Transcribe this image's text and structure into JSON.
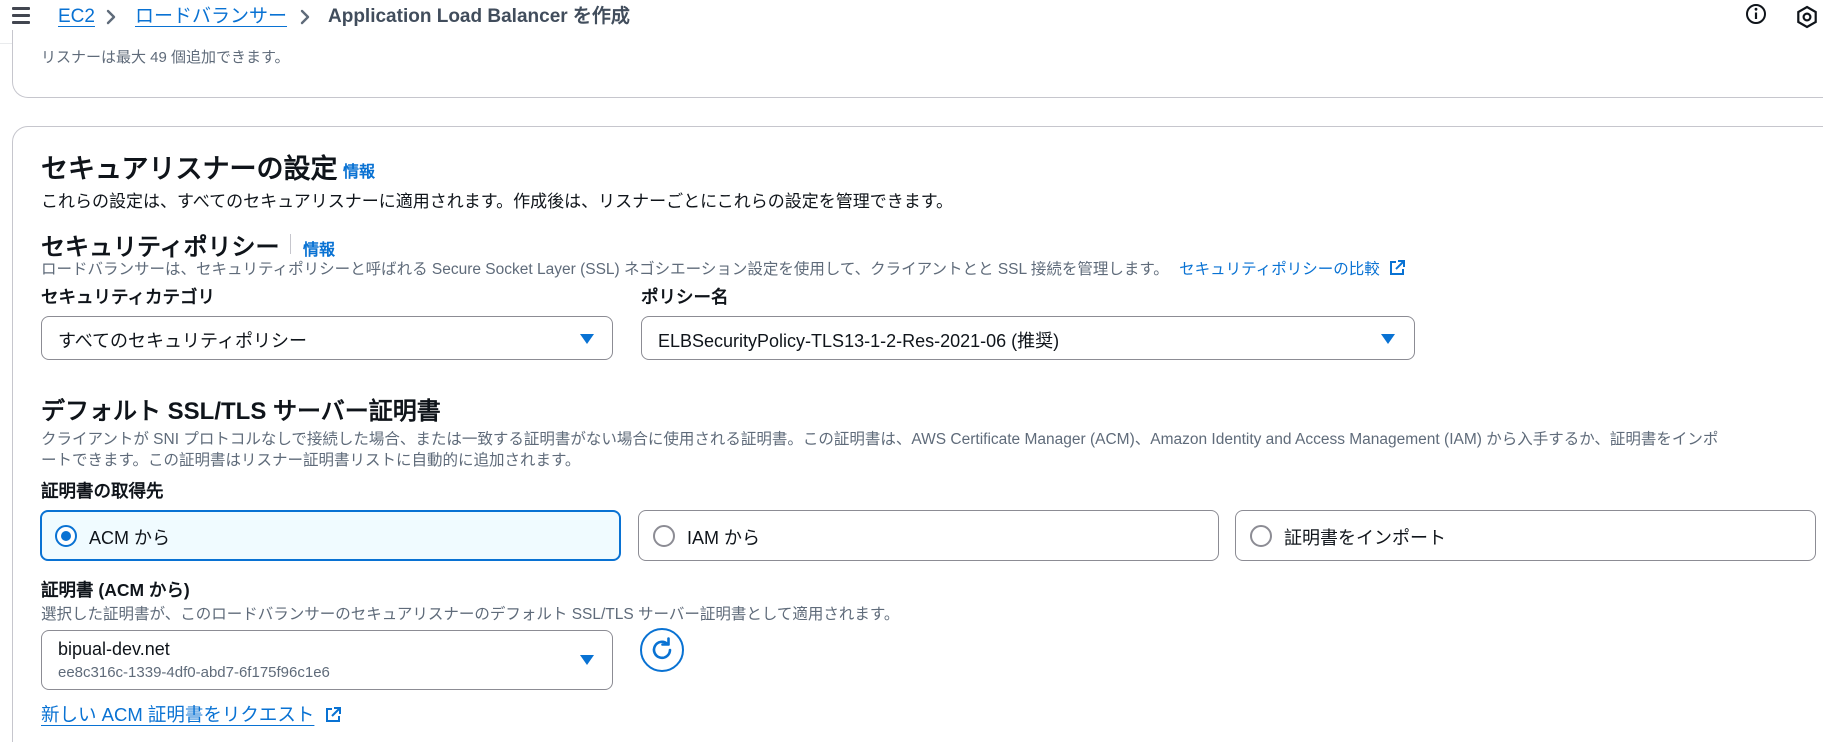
{
  "header": {
    "breadcrumb": {
      "ec2": "EC2",
      "load_balancers": "ロードバランサー",
      "current": "Application Load Balancer を作成"
    },
    "icons": [
      "menu-icon",
      "chevron-right-icon",
      "info-icon",
      "settings-hex-icon"
    ]
  },
  "listener_note": "リスナーは最大 49 個追加できます。",
  "secure_listener": {
    "title": "セキュアリスナーの設定",
    "info": "情報",
    "description": "これらの設定は、すべてのセキュアリスナーに適用されます。作成後は、リスナーごとにこれらの設定を管理できます。",
    "security_policy": {
      "title": "セキュリティポリシー",
      "info": "情報",
      "description": "ロードバランサーは、セキュリティポリシーと呼ばれる Secure Socket Layer (SSL) ネゴシエーション設定を使用して、クライアントとと SSL 接続を管理します。",
      "compare_link": "セキュリティポリシーの比較",
      "category_label": "セキュリティカテゴリ",
      "category_value": "すべてのセキュリティポリシー",
      "policy_label": "ポリシー名",
      "policy_value": "ELBSecurityPolicy-TLS13-1-2-Res-2021-06 (推奨)"
    },
    "default_cert": {
      "title": "デフォルト SSL/TLS サーバー証明書",
      "description_line1": "クライアントが SNI プロトコルなしで接続した場合、または一致する証明書がない場合に使用される証明書。この証明書は、AWS Certificate Manager (ACM)、Amazon Identity and Access Management (IAM) から入手するか、証明書をインポ",
      "description_line2": "ートできます。この証明書はリスナー証明書リストに自動的に追加されます。",
      "source_label": "証明書の取得先",
      "sources": [
        {
          "label": "ACM から",
          "selected": true
        },
        {
          "label": "IAM から",
          "selected": false
        },
        {
          "label": "証明書をインポート",
          "selected": false
        }
      ],
      "acm_label": "証明書 (ACM から)",
      "acm_description": "選択した証明書が、このロードバランサーのセキュアリスナーのデフォルト SSL/TLS サーバー証明書として適用されます。",
      "acm_cert_name": "bipual-dev.net",
      "acm_cert_id": "ee8c316c-1339-4df0-abd7-6f175f96c1e6",
      "request_link": "新しい ACM 証明書をリクエスト"
    }
  },
  "colors": {
    "link": "#0972d3",
    "selected_bg": "#f0fbff",
    "border": "#8c8c94",
    "text": "#0f141a",
    "secondary_text": "#5f6b7a"
  }
}
